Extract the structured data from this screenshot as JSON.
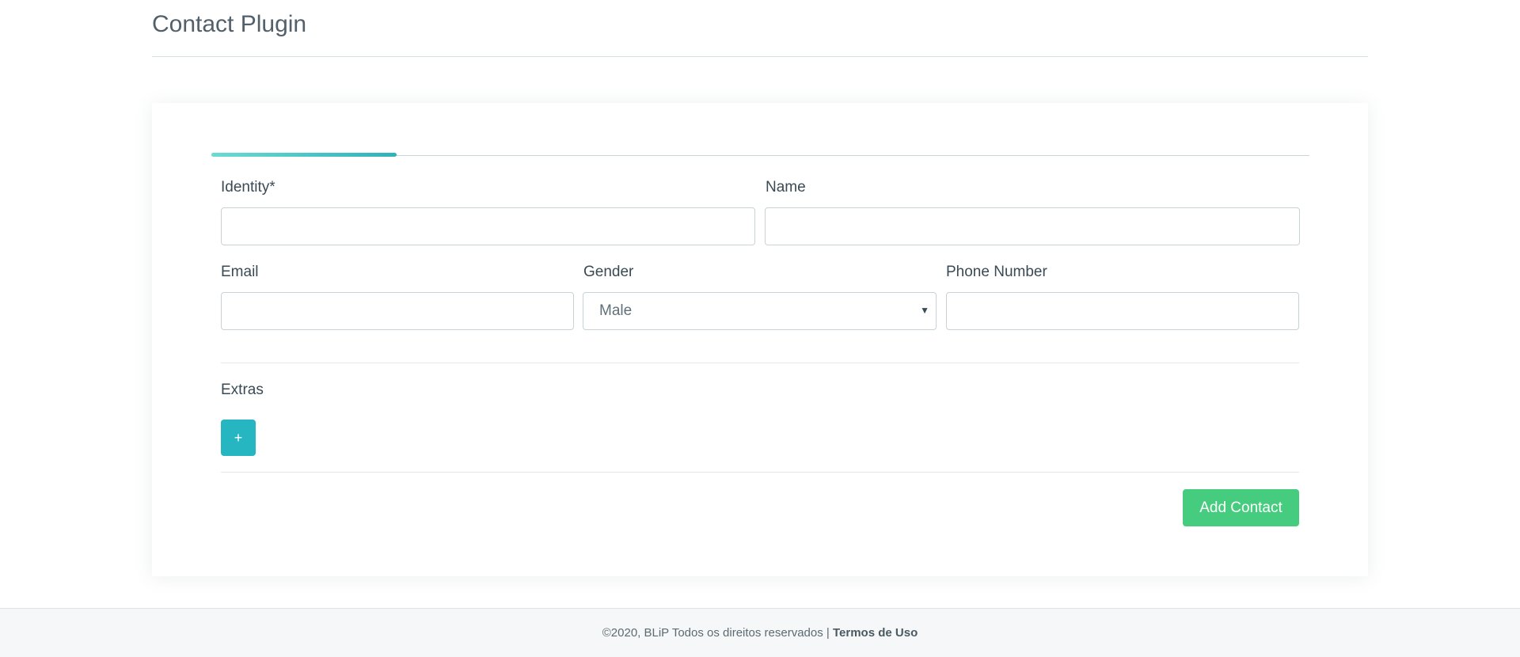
{
  "header": {
    "title": "Contact Plugin"
  },
  "tabs": [
    {
      "label": "",
      "active": true
    }
  ],
  "form": {
    "identity": {
      "label": "Identity*",
      "value": "",
      "placeholder": ""
    },
    "name": {
      "label": "Name",
      "value": "",
      "placeholder": ""
    },
    "email": {
      "label": "Email",
      "value": "",
      "placeholder": ""
    },
    "gender": {
      "label": "Gender",
      "selected": "Male"
    },
    "phone": {
      "label": "Phone Number",
      "value": "",
      "placeholder": ""
    },
    "extras": {
      "label": "Extras",
      "add_label": "+"
    },
    "submit_label": "Add Contact"
  },
  "footer": {
    "copyright": "©2020, BLiP Todos os direitos reservados | ",
    "terms_link": "Termos de Uso"
  },
  "colors": {
    "tab_accent_start": "#6adbd3",
    "tab_accent_end": "#2fb2b9",
    "extra_button": "#25b6c2",
    "submit_button": "#46cc7e"
  },
  "icons": {
    "select_arrow": "caret-down-icon",
    "add": "plus-icon"
  }
}
